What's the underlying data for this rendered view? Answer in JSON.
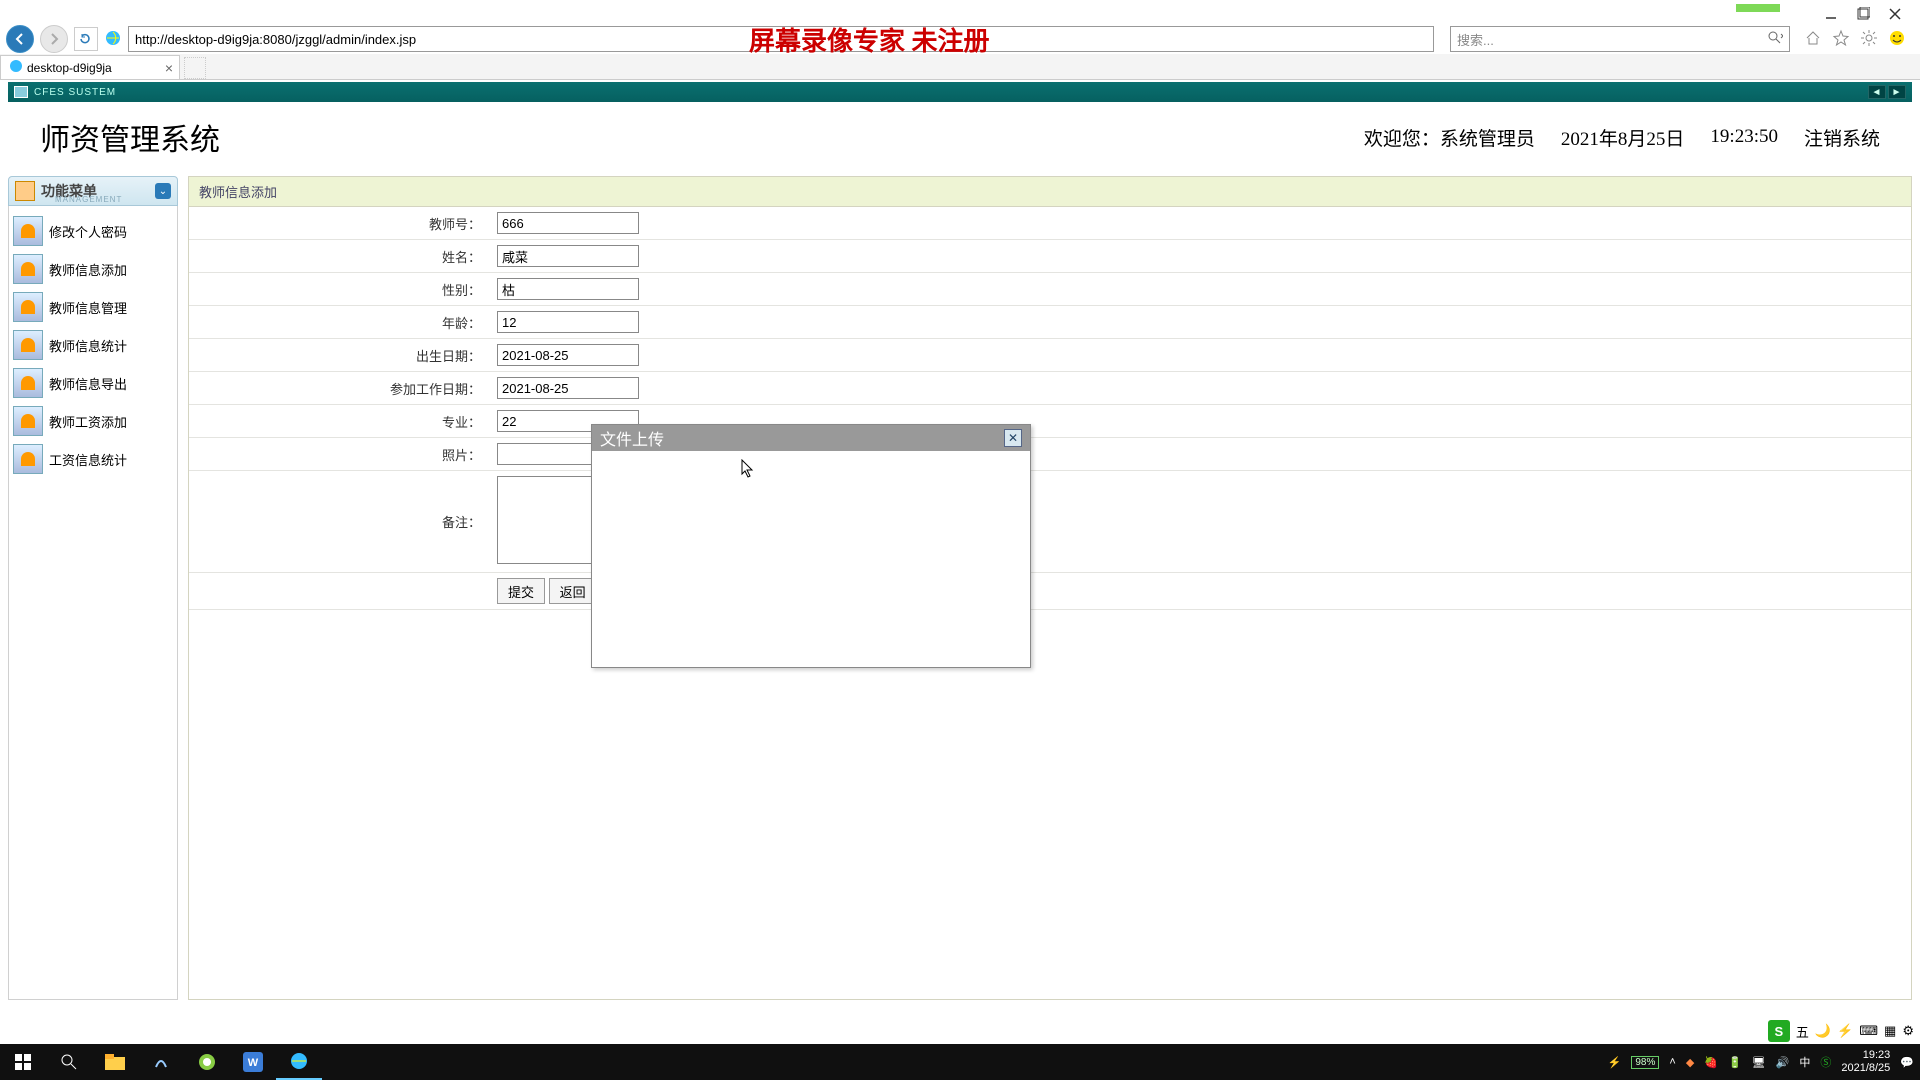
{
  "browser": {
    "url": "http://desktop-d9ig9ja:8080/jzggl/admin/index.jsp",
    "overlay_text": "屏幕录像专家  未注册",
    "search_placeholder": "搜索...",
    "tab_title": "desktop-d9ig9ja"
  },
  "app": {
    "titlebar": "CFES SUSTEM"
  },
  "header": {
    "system_title": "师资管理系统",
    "welcome": "欢迎您：系统管理员",
    "date": "2021年8月25日",
    "time": "19:23:50",
    "logout": "注销系统"
  },
  "sidebar": {
    "title": "功能菜单",
    "subtitle": "MANAGEMENT",
    "items": [
      {
        "label": "修改个人密码"
      },
      {
        "label": "教师信息添加"
      },
      {
        "label": "教师信息管理"
      },
      {
        "label": "教师信息统计"
      },
      {
        "label": "教师信息导出"
      },
      {
        "label": "教师工资添加"
      },
      {
        "label": "工资信息统计"
      }
    ]
  },
  "form": {
    "panel_title": "教师信息添加",
    "fields": {
      "teacher_no": {
        "label": "教师号：",
        "value": "666"
      },
      "name": {
        "label": "姓名：",
        "value": "咸菜"
      },
      "gender": {
        "label": "性别：",
        "value": "枯"
      },
      "age": {
        "label": "年龄：",
        "value": "12"
      },
      "birth": {
        "label": "出生日期：",
        "value": "2021-08-25"
      },
      "workdate": {
        "label": "参加工作日期：",
        "value": "2021-08-25"
      },
      "major": {
        "label": "专业：",
        "value": "22"
      },
      "photo": {
        "label": "照片：",
        "value": ""
      },
      "remark": {
        "label": "备注：",
        "value": ""
      }
    },
    "submit": "提交",
    "back": "返回"
  },
  "modal": {
    "title": "文件上传"
  },
  "ime": {
    "badge": "S",
    "label": "五"
  },
  "systray": {
    "battery": "98%",
    "ime": "中",
    "time": "19:23",
    "date": "2021/8/25"
  }
}
